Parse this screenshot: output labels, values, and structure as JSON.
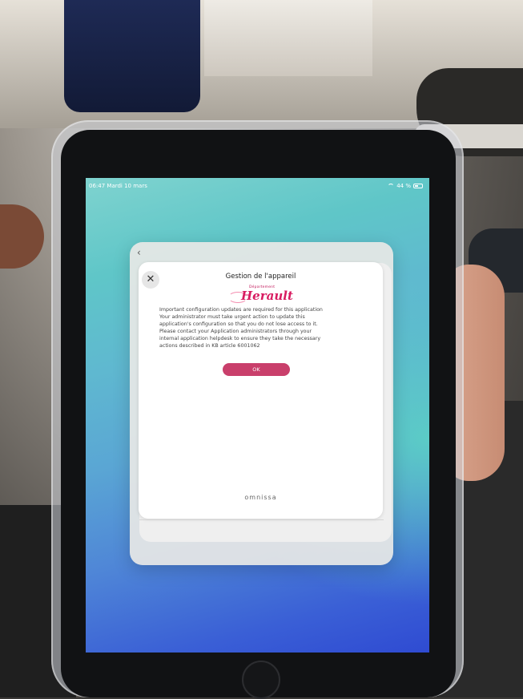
{
  "status_bar": {
    "time_date": "06:47  Mardi 10 mars",
    "battery_text": "44 %"
  },
  "dialog": {
    "title": "Gestion de l'appareil",
    "logo_small": "Département",
    "logo_main": "Herault",
    "message_lines": [
      "Important configuration updates are required for this application",
      "Your administrator must take urgent action to update this",
      "application's configuration so that you do not lose access to it.",
      "Please contact your Application administrators through your",
      "internal application helpdesk to ensure they take the necessary",
      "actions described in KB article 6001062"
    ],
    "ok_label": "OK",
    "brand": "omnissa",
    "close_label": "✕",
    "back_label": "‹"
  },
  "colors": {
    "accent": "#c93f6b",
    "logo": "#d81b60"
  },
  "icons": [
    "wifi-icon",
    "battery-icon",
    "close-icon",
    "back-chevron-icon"
  ]
}
